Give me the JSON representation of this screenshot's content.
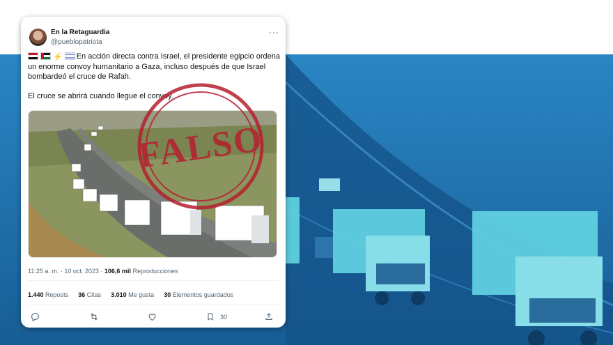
{
  "tweet": {
    "author_name": "En la Retaguardia",
    "author_handle": "@pueblopatriota",
    "paragraph1": "En acción directa contra Israel, el presidente egipcio ordena un enorme convoy humanitario a Gaza, incluso después de que Israel bombardeó el cruce de Rafah.",
    "paragraph2": "El cruce se abrirá cuando llegue el convoy.",
    "timestamp": "11:25 a. m. · 10 oct. 2023 · ",
    "views_count": "106,6 mil",
    "views_label": " Reproducciones",
    "reposts_count": "1.440",
    "reposts_label": "Reposts",
    "quotes_count": "36",
    "quotes_label": "Citas",
    "likes_count": "3.010",
    "likes_label": "Me gusta",
    "bookmarks_count": "30",
    "bookmarks_label": "Elementos guardados",
    "bookmark_action_count": "30",
    "more_glyph": "···"
  },
  "stamp": {
    "text": "FALSO",
    "color": "#b5202e"
  },
  "icons": [
    "reply-icon",
    "repost-icon",
    "like-icon",
    "bookmark-icon",
    "share-icon",
    "more-icon"
  ],
  "colors": {
    "background_duotone": "#1a6aa6",
    "text_primary": "#0f1419",
    "text_secondary": "#536471"
  }
}
